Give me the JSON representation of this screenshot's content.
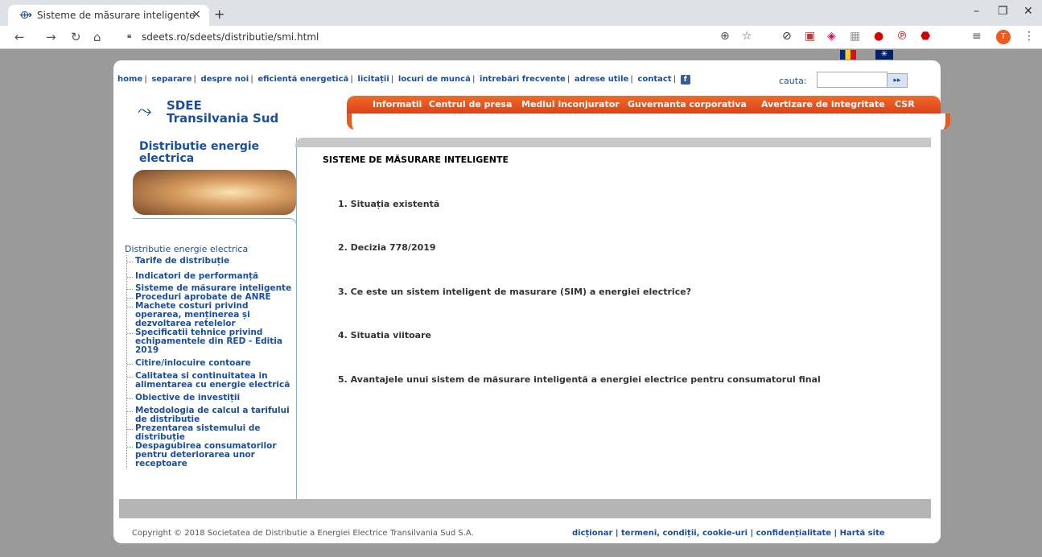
{
  "browser": {
    "tab_title": "Sisteme de măsurare inteligente",
    "tab_close": "×",
    "new_tab": "+",
    "url": "sdeets.ro/sdeets/distributie/smi.html",
    "profile_initial": "T",
    "window_min": "–",
    "window_max": "❐",
    "window_close": "✕"
  },
  "header": {
    "top_links": [
      "home",
      "separare",
      "despre noi",
      "eficientă energetică",
      "licitații",
      "locuri de muncă",
      "întrebări frecvente",
      "adrese utile",
      "contact"
    ],
    "search_label": "cauta:",
    "search_button": "▸▸",
    "logo_line1": "SDEE",
    "logo_line2": "Transilvania Sud"
  },
  "main_nav": [
    "Informatii",
    "Centrul de presa",
    "Mediul inconjurator",
    "Guvernanta corporativa",
    "Avertizare de integritate",
    "CSR"
  ],
  "sidebar": {
    "title": "Distributie energie electrica",
    "tree_root": "Distributie energie electrica",
    "items": [
      "Tarife de distribuție",
      "Indicatori de performanță",
      "Sisteme de măsurare inteligente",
      "Proceduri aprobate de ANRE",
      "Machete costuri privind operarea, menținerea și dezvoltarea retelelor",
      "Specificatii tehnice privind echipamentele din RED - Editia 2019",
      "Citire/inlocuire contoare",
      "Calitatea si continuitatea in alimentarea cu energie electrică",
      "Obiective de investiții",
      "Metodologia de calcul a tarifului de distributie",
      "Prezentarea sistemului de distribuție",
      "Despagubirea consumatorilor pentru deteriorarea unor receptoare"
    ]
  },
  "content": {
    "title": "SISTEME DE MĂSURARE INTELIGENTE",
    "items": [
      "1. Situația existentă",
      "2. Decizia 778/2019",
      "3. Ce este un sistem inteligent de masurare (SIM) a energiei electrice?",
      "4. Situatia viitoare",
      "5. Avantajele unui sistem de măsurare inteligentă a energiei electrice pentru consumatorul final"
    ]
  },
  "footer": {
    "copyright": "Copyright © 2018 Societatea de Distributie a Energiei Electrice Transilvania Sud S.A.",
    "links": "dicționar | termeni, condiții, cookie-uri | confidențialitate | Hartă site"
  }
}
